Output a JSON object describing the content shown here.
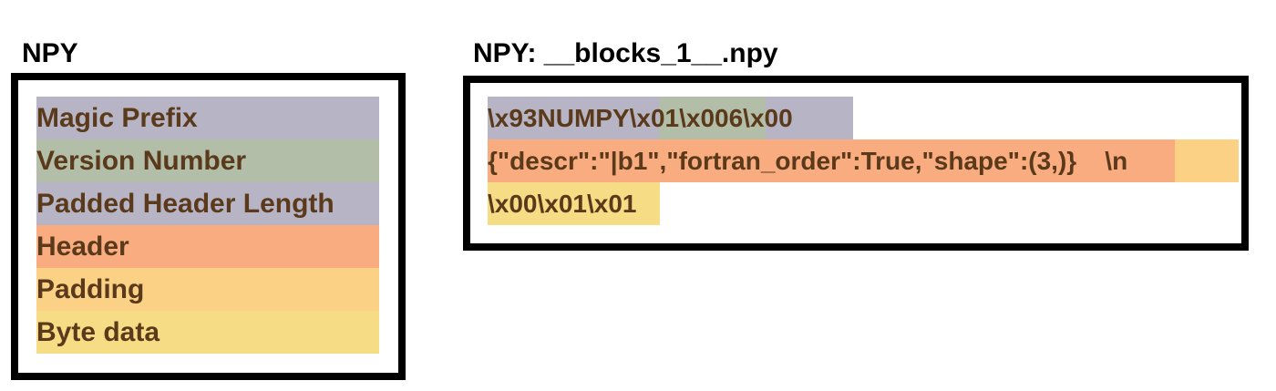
{
  "legend": {
    "title": "NPY",
    "items": [
      {
        "label": "Magic Prefix",
        "color": "#b7b5c5"
      },
      {
        "label": "Version Number",
        "color": "#b3bea9"
      },
      {
        "label": "Padded Header Length",
        "color": "#b7b5c5"
      },
      {
        "label": "Header",
        "color": "#f9ac7f"
      },
      {
        "label": "Padding",
        "color": "#fbd285"
      },
      {
        "label": "Byte data",
        "color": "#f7dc86"
      }
    ]
  },
  "example": {
    "title": "NPY: __blocks_1__.npy",
    "lines": [
      "\\x93NUMPY\\x01\\x006\\x00",
      "{\"descr\":\"|b1\",\"fortran_order\":True,\"shape\":(3,)}    \\n",
      "\\x00\\x01\\x01"
    ]
  },
  "text_color": "#5a3a1a"
}
